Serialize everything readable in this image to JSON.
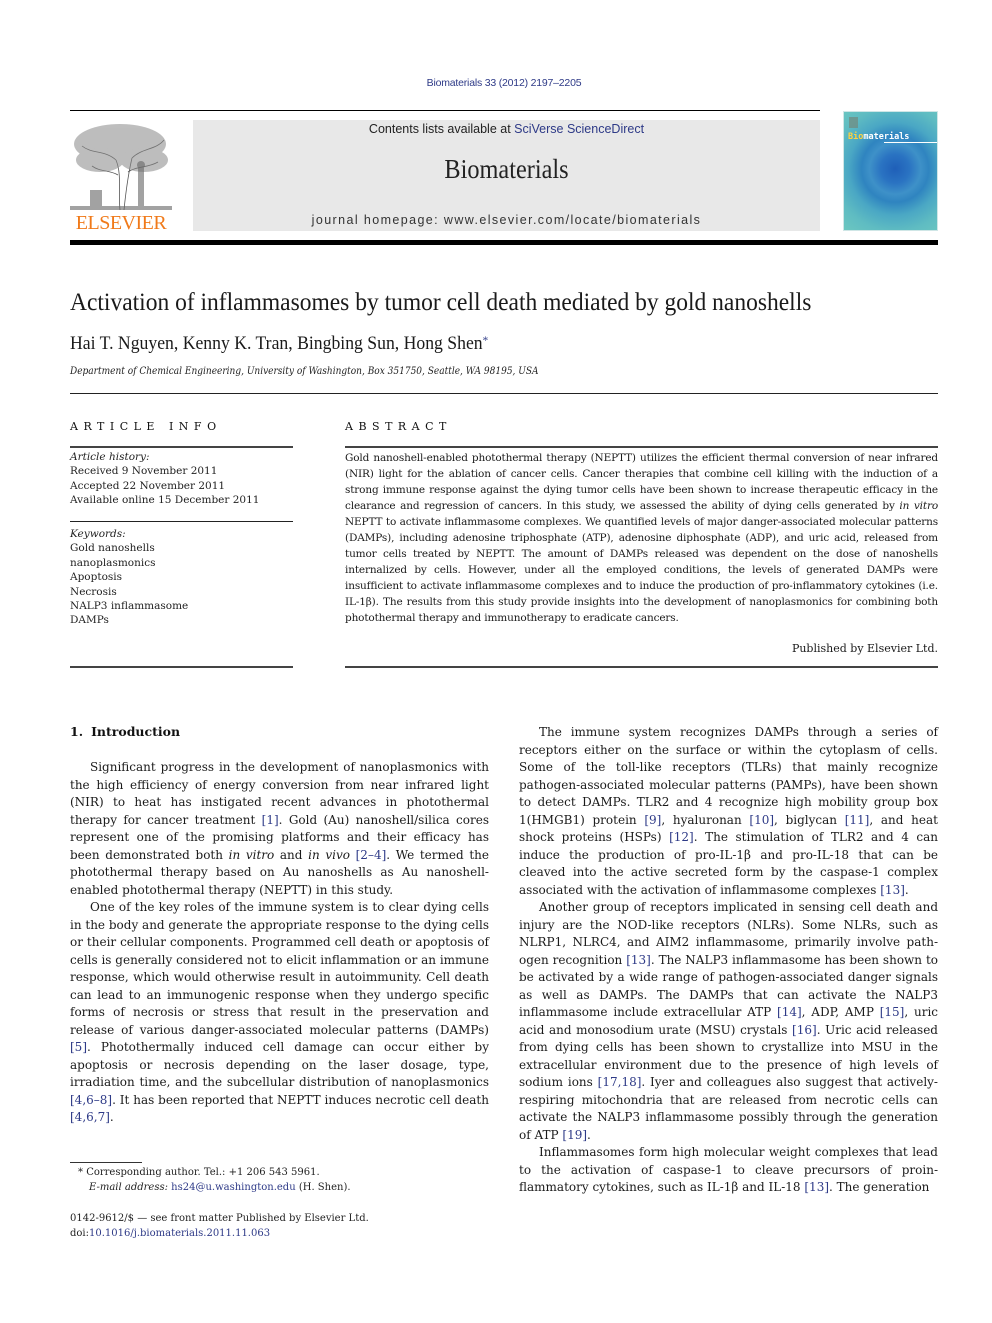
{
  "header": {
    "journal_reference": "Biomaterials 33 (2012) 2197–2205",
    "contents_prefix": "Contents lists available at ",
    "contents_link": "SciVerse ScienceDirect",
    "journal_name": "Biomaterials",
    "homepage_line": "journal homepage: www.elsevier.com/locate/biomaterials",
    "publisher_logo_text": "ELSEVIER",
    "cover_title_accent": "Bio",
    "cover_title_rest": "materials",
    "colors": {
      "link": "#2e3a87",
      "elsevier_orange": "#f07a1a",
      "header_box": "#e8e8e8"
    }
  },
  "article": {
    "title": "Activation of inflammasomes by tumor cell death mediated by gold nanoshells",
    "authors": "Hai T. Nguyen, Kenny K. Tran, Bingbing Sun, Hong Shen",
    "corresponding_marker": "*",
    "affiliation": "Department of Chemical Engineering, University of Washington, Box 351750, Seattle, WA 98195, USA"
  },
  "article_info": {
    "heading": "ARTICLE INFO",
    "history_label": "Article history:",
    "history": [
      "Received 9 November 2011",
      "Accepted 22 November 2011",
      "Available online 15 December 2011"
    ],
    "keywords_label": "Keywords:",
    "keywords": [
      "Gold nanoshells",
      "nanoplasmonics",
      "Apoptosis",
      "Necrosis",
      "NALP3 inflammasome",
      "DAMPs"
    ]
  },
  "abstract": {
    "heading": "ABSTRACT",
    "part1": "Gold nanoshell-enabled photothermal therapy (NEPTT) utilizes the efficient thermal conversion of near infrared (NIR) light for the ablation of cancer cells. Cancer therapies that combine cell killing with the induction of a strong immune response against the dying tumor cells have been shown to increase therapeutic efficacy in the clearance and regression of cancers. In this study, we assessed the ability of dying cells generated by ",
    "italic": "in vitro",
    "part2": " NEPTT to activate inflammasome complexes. We quantified levels of major danger-associated molecular patterns (DAMPs), including adenosine triphosphate (ATP), adeno­sine diphosphate (ADP), and uric acid, released from tumor cells treated by NEPTT. The amount of DAMPs released was dependent on the dose of nanoshells internalized by cells. However, under all the employed conditions, the levels of generated DAMPs were insufficient to activate inflammasome complexes and to induce the production of pro-inflammatory cytokines (i.e. IL-1β). The results from this study provide insights into the development of nanoplasmonics for combining both photothermal therapy and immunotherapy to eradicate cancers.",
    "publisher": "Published by Elsevier Ltd."
  },
  "introduction": {
    "number": "1.",
    "title": "Introduction",
    "p1": {
      "a": "Significant progress in the development of nanoplasmonics with the high efficiency of energy conversion from near infrared light (NIR) to heat has instigated recent advances in photo­thermal therapy for cancer treatment ",
      "ref1": "[1]",
      "b": ". Gold (Au) nanoshell/silica cores represent one of the promising platforms and their efficacy has been demonstrated both ",
      "it1": "in vitro",
      "c": " and ",
      "it2": "in vivo",
      "d": " ",
      "ref2": "[2–4]",
      "e": ". We termed the photothermal therapy based on Au nanoshells as Au nanoshell-enabled photothermal therapy (NEPTT) in this study."
    },
    "p2": {
      "a": "One of the key roles of the immune system is to clear dying cells in the body and generate the appropriate response to the dying cells or their cellular components. Programmed cell death or apoptosis of cells is generally considered not to elicit inflammation or an immune response, which would otherwise result in autoim­munity. Cell death can lead to an immunogenic response when they undergo specific forms of necrosis or stress that result in the preservation and release of various danger-associated molecular patterns (DAMPs) ",
      "ref1": "[5]",
      "b": ". Photothermally induced cell damage can occur either by apoptosis or necrosis depending on the laser dosage, type, irradiation time, and the subcellular distribution of nanoplasmonics ",
      "ref2": "[4,6–8]",
      "c": ". It has been reported that NEPTT induces necrotic cell death ",
      "ref3": "[4,6,7]",
      "d": "."
    },
    "p3": {
      "a": "The immune system recognizes DAMPs through a series of receptors either on the surface or within the cytoplasm of cells. Some of the toll-like receptors (TLRs) that mainly recognize pathogen-associated molecular patterns (PAMPs), have been shown to detect DAMPs. TLR2 and 4 recognize high mobility group box 1(HMGB1) protein ",
      "ref1": "[9]",
      "b": ", hyaluronan ",
      "ref2": "[10]",
      "c": ", biglycan ",
      "ref3": "[11]",
      "d": ", and heat shock proteins (HSPs) ",
      "ref4": "[12]",
      "e": ". The stimulation of TLR2 and 4 can induce the production of pro-IL-1β and pro-IL-18 that can be cleaved into the active secreted form by the caspase-1 complex associated with the activation of inflammasome complexes ",
      "ref5": "[13]",
      "f": "."
    },
    "p4": {
      "a": "Another group of receptors implicated in sensing cell death and injury are the NOD-like receptors (NLRs). Some NLRs, such as NLRP1, NLRC4, and AIM2 inflammasome, primarily involve path­ogen recognition ",
      "ref1": "[13]",
      "b": ". The NALP3 inflammasome has been shown to be activated by a wide range of pathogen-associated danger signals as well as DAMPs. The DAMPs that can activate the NALP3 inflammasome include extracellular ATP ",
      "ref2": "[14]",
      "c": ", ADP, AMP ",
      "ref3": "[15]",
      "d": ", uric acid and monosodium urate (MSU) crystals ",
      "ref4": "[16]",
      "e": ". Uric acid released from dying cells has been shown to crystallize into MSU in the extracellular environment due to the presence of high levels of sodium ions ",
      "ref5": "[17,18]",
      "f": ". Iyer and colleagues also suggest that actively-respiring mitochondria that are released from necrotic cells can activate the NALP3 inflammasome possibly through the generation of ATP ",
      "ref6": "[19]",
      "g": "."
    },
    "p5": {
      "a": "Inflammasomes form high molecular weight complexes that lead to the activation of caspase-1 to cleave precursors of proin­flammatory cytokines, such as IL-1β and IL-18 ",
      "ref1": "[13]",
      "b": ". The generation"
    }
  },
  "footnote": {
    "marker": "*",
    "text": "Corresponding author. Tel.: +1 206 543 5961.",
    "email_label": "E-mail address:",
    "email": "hs24@u.washington.edu",
    "email_suffix": " (H. Shen)."
  },
  "front_matter": {
    "issn_line": "0142-9612/$ — see front matter Published by Elsevier Ltd.",
    "doi_label": "doi:",
    "doi": "10.1016/j.biomaterials.2011.11.063"
  }
}
